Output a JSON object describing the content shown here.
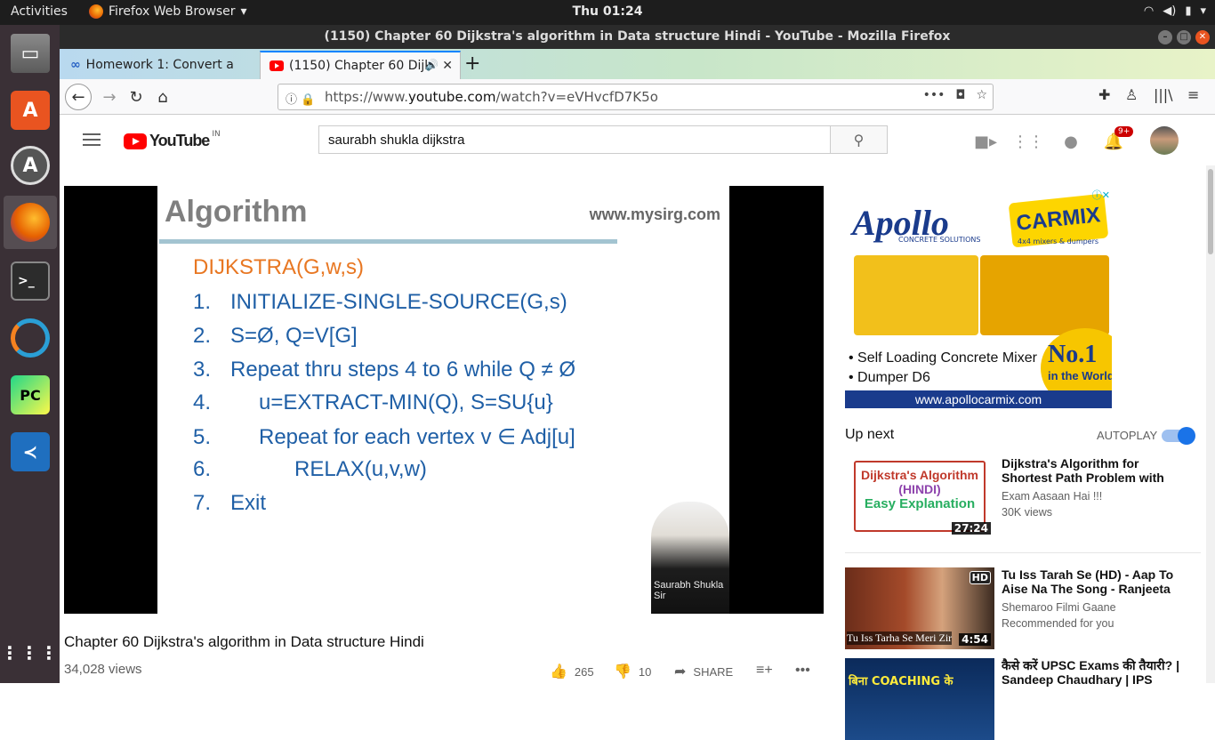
{
  "system": {
    "activities": "Activities",
    "app_menu": "Firefox Web Browser",
    "clock": "Thu 01:24"
  },
  "window": {
    "title": "(1150) Chapter 60 Dijkstra's algorithm in Data structure Hindi - YouTube - Mozilla Firefox"
  },
  "tabs": [
    {
      "label": "Homework 1: Convert a",
      "active": false
    },
    {
      "label": "(1150) Chapter 60 Dijk",
      "active": true
    }
  ],
  "urlbar": {
    "prefix": "https://www.",
    "domain": "youtube.com",
    "suffix": "/watch?v=eVHvcfD7K5o"
  },
  "youtube": {
    "logo": "YouTube",
    "country": "IN",
    "search_value": "saurabh shukla dijkstra",
    "notification_badge": "9+"
  },
  "video": {
    "slide": {
      "title": "Algorithm",
      "site": "www.mysirg.com",
      "heading": "DIJKSTRA(G,w,s)",
      "lines": [
        {
          "num": "1.",
          "text": "INITIALIZE-SINGLE-SOURCE(G,s)"
        },
        {
          "num": "2.",
          "text": "S=Ø, Q=V[G]"
        },
        {
          "num": "3.",
          "text": "Repeat thru steps 4 to 6 while Q ≠ Ø"
        },
        {
          "num": "4.",
          "text": "u=EXTRACT-MIN(Q), S=SU{u}"
        },
        {
          "num": "5.",
          "text": "Repeat for each vertex v ∈ Adj[u]"
        },
        {
          "num": "6.",
          "text": "RELAX(u,v,w)"
        },
        {
          "num": "7.",
          "text": "Exit"
        }
      ],
      "author": "Saurabh Shukla Sir"
    },
    "title": "Chapter 60 Dijkstra's algorithm in Data structure Hindi",
    "views": "34,028 views",
    "likes": "265",
    "dislikes": "10",
    "share": "SHARE"
  },
  "ad": {
    "brand": "Apollo",
    "brand_sub": "CONCRETE SOLUTIONS",
    "product_brand": "CARMIX",
    "product_sub": "4x4 mixers & dumpers",
    "bullet1": "• Self Loading Concrete Mixer",
    "bullet2": "• Dumper D6",
    "badge_big": "No.1",
    "badge_small": "in the World",
    "url": "www.apollocarmix.com"
  },
  "sidebar": {
    "up_next": "Up next",
    "autoplay": "AUTOPLAY",
    "autoplay_on": true,
    "recommendations": [
      {
        "thumb_lines": [
          "Dijkstra's Algorithm",
          "(HINDI)",
          "Easy Explanation"
        ],
        "duration": "27:24",
        "title": "Dijkstra's Algorithm for Shortest Path Problem with Example in",
        "channel": "Exam Aasaan Hai !!!",
        "meta": "30K views"
      },
      {
        "thumb_caption": "Tu Iss Tarha Se Meri Zir",
        "thumb_hd": "HD",
        "duration": "4:54",
        "title": "Tu Iss Tarah Se (HD) - Aap To Aise Na The Song - Ranjeeta",
        "channel": "Shemaroo Filmi Gaane",
        "meta": "Recommended for you"
      },
      {
        "thumb_caption": "बिना COACHING के",
        "title": "कैसे करें UPSC Exams की तैयारी? | Sandeep Chaudhary | IPS"
      }
    ]
  }
}
